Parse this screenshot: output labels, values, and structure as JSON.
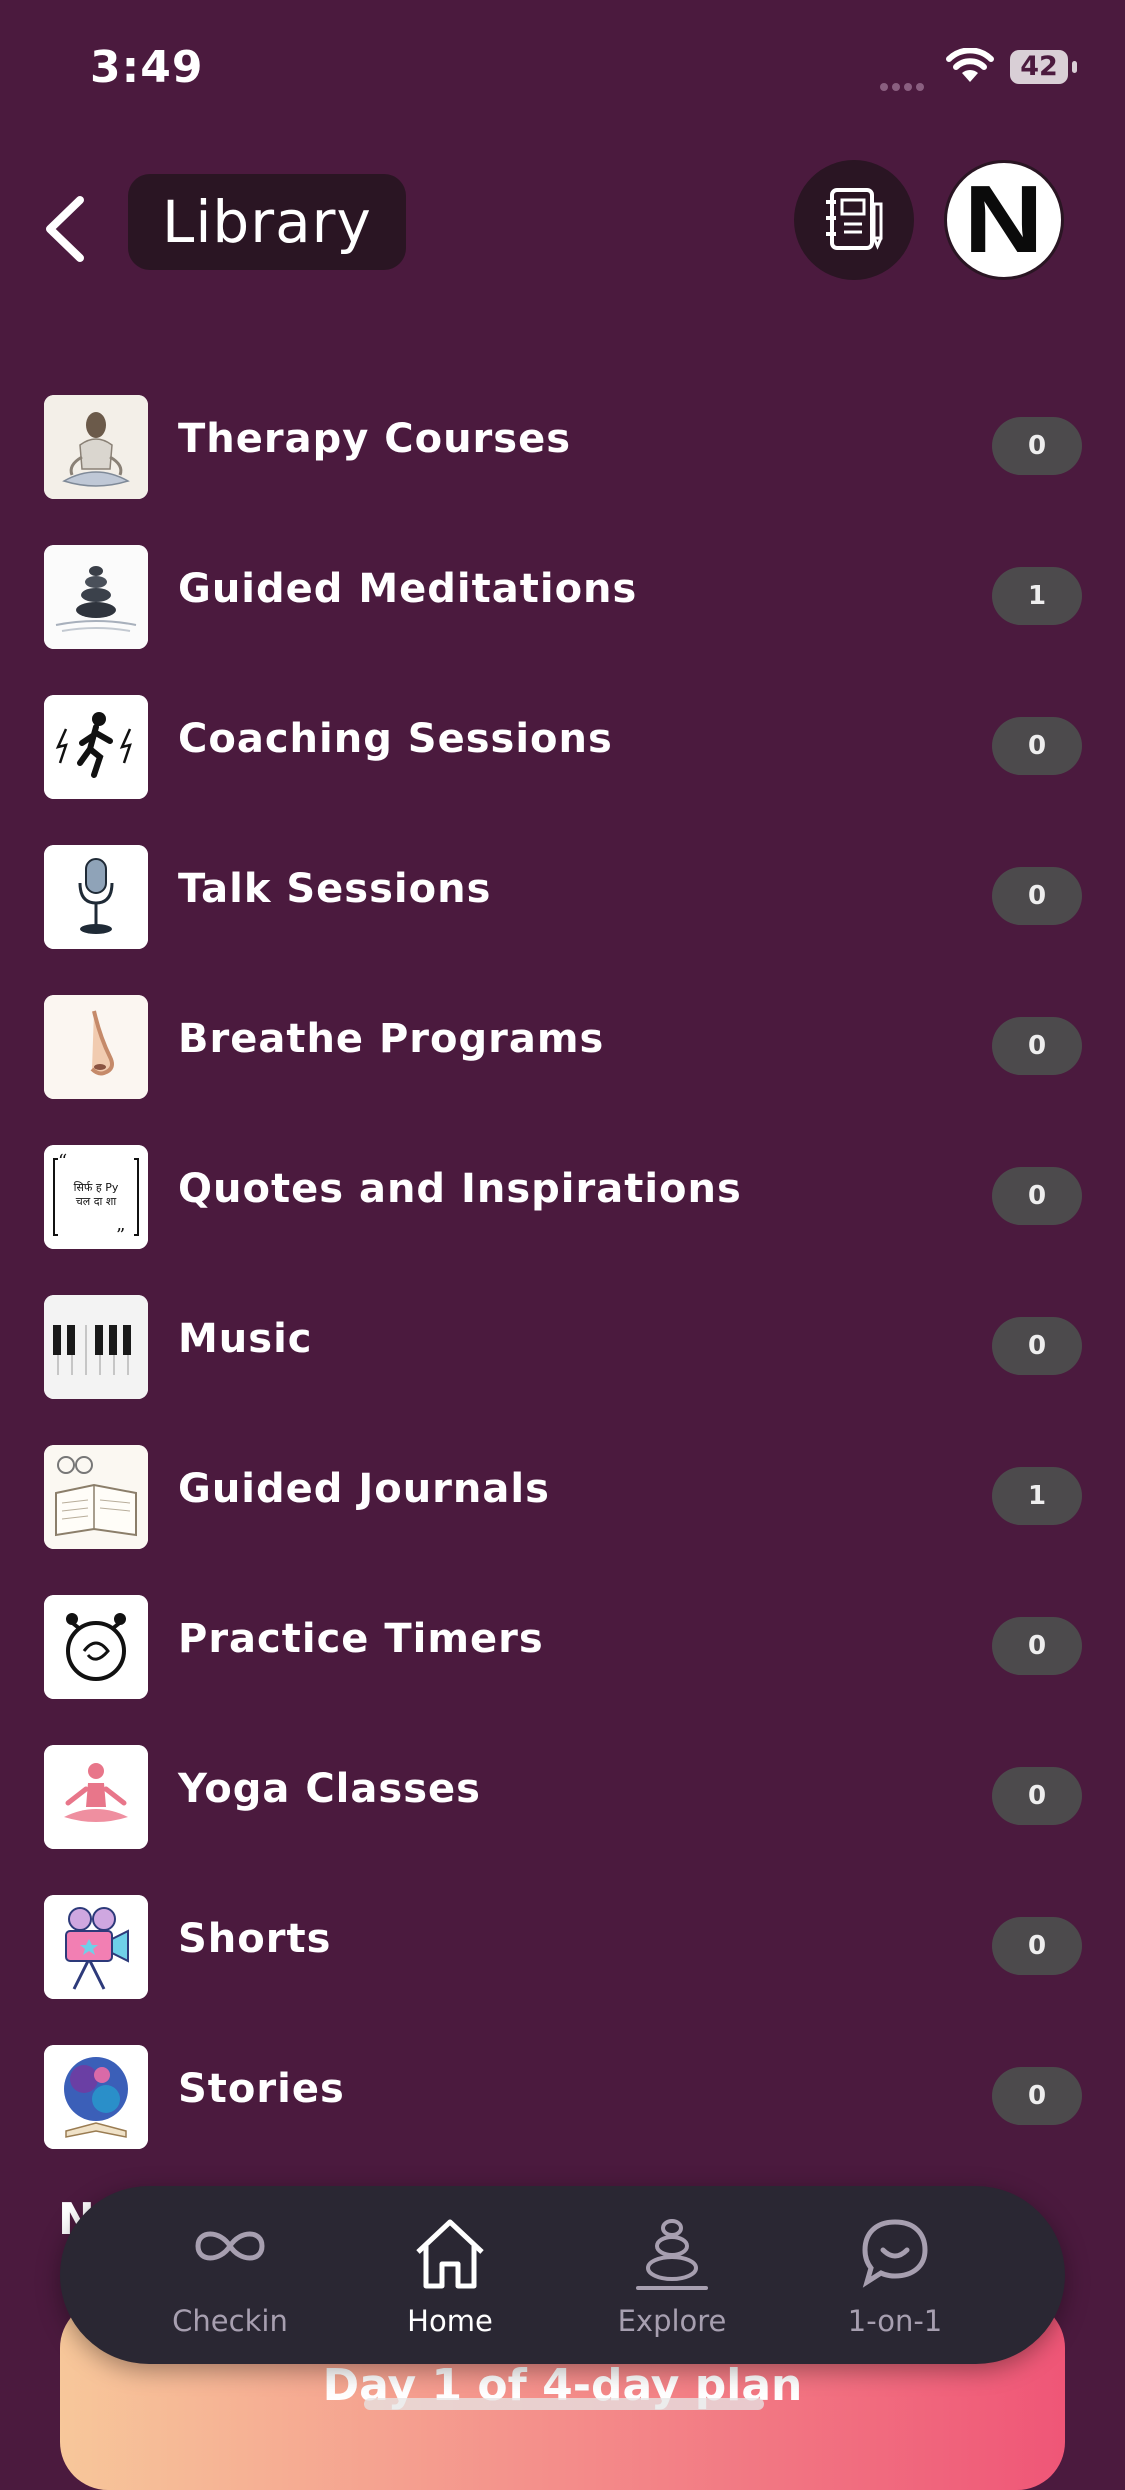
{
  "status": {
    "time": "3:49",
    "battery": "42"
  },
  "header": {
    "title": "Library"
  },
  "avatar": {
    "letter": "N"
  },
  "items": [
    {
      "label": "Therapy Courses",
      "count": "0",
      "icon": "meditating-woman-icon"
    },
    {
      "label": "Guided Meditations",
      "count": "1",
      "icon": "stacked-stones-icon"
    },
    {
      "label": "Coaching Sessions",
      "count": "0",
      "icon": "runner-lightning-icon"
    },
    {
      "label": "Talk Sessions",
      "count": "0",
      "icon": "microphone-icon"
    },
    {
      "label": "Breathe Programs",
      "count": "0",
      "icon": "nose-icon"
    },
    {
      "label": "Quotes and Inspirations",
      "count": "0",
      "icon": "quote-card-icon"
    },
    {
      "label": "Music",
      "count": "0",
      "icon": "piano-keys-icon"
    },
    {
      "label": "Guided Journals",
      "count": "1",
      "icon": "journal-icon"
    },
    {
      "label": "Practice Timers",
      "count": "0",
      "icon": "alarm-clock-icon"
    },
    {
      "label": "Yoga Classes",
      "count": "0",
      "icon": "yoga-pose-icon"
    },
    {
      "label": "Shorts",
      "count": "0",
      "icon": "film-camera-icon"
    },
    {
      "label": "Stories",
      "count": "0",
      "icon": "storybook-icon"
    }
  ],
  "quote_card": {
    "text_line1": "सिर्फ ह Py",
    "text_line2": "चल दा शा"
  },
  "tabs": [
    {
      "label": "Checkin",
      "icon": "infinity-icon",
      "active": false
    },
    {
      "label": "Home",
      "icon": "home-icon",
      "active": true
    },
    {
      "label": "Explore",
      "icon": "stones-icon",
      "active": false
    },
    {
      "label": "1-on-1",
      "icon": "chat-bubble-icon",
      "active": false
    }
  ],
  "plan_banner": {
    "text": "Day 1 of 4-day plan"
  },
  "section_peek": {
    "letter": "N"
  },
  "colors": {
    "background": "#4b1a3e",
    "pill": "#2a1523",
    "badge": "#4c4a4c",
    "tabbar": "#2a2733"
  }
}
